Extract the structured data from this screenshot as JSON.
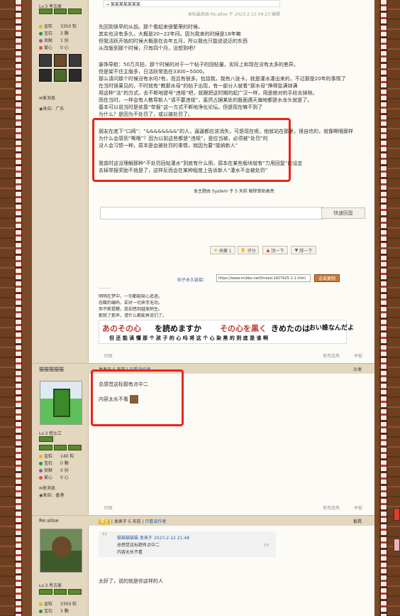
{
  "top_box": "→ 某某某某某某某",
  "post1": {
    "side": {
      "level": "Lv.3 考古家",
      "stats": [
        {
          "label": "金粒",
          "value": "3350 粒",
          "color": "#e6b800"
        },
        {
          "label": "宝石",
          "value": "3 颗",
          "color": "#1e9b3c"
        },
        {
          "label": "贡献",
          "value": "1 份",
          "color": "#9b59b6"
        },
        {
          "label": "爱心",
          "value": "0 心",
          "color": "#e74c3c"
        }
      ],
      "send_msg": "发消息",
      "from": "来自：广东"
    },
    "edited": "本帖最后由 Re:alloe 于 2023-2-13 04:23 编辑",
    "paragraphs": [
      "先回到很早的从前。那个看起来很繁荣的时候。",
      "其实也没有多久，大概是20~22年间。因为我来的时候是18年嘛",
      "但我活跃开始的时候大概是在去年五月，所以我也只能说说近的东西",
      "从改版到那个时候，只有四个月，没想到吧?",
      "",
      "装饰导航：50万共拍，那个时候的对于一个帖子的回帖量，实际上和现在没有太多的差异。",
      "但是架不住主版多，日活跃常态在3300~5000。",
      "那么请问那个时候没有水吗?有，而且有很多。包括我，我有八张卡，就是灌水灌出来的，不过那是20年的事情了",
      "在当时很果见的，不时就有“教那水母”的帖子出现，有一部分人就看“那水母”挣得盆满钵满",
      "用这种“法”的方式，去不断地提号“违规”吧，就跟把这时期的起广汉一样，用是绝对的手段去抹除。",
      "而在当时，一样会有人教导新人“请不要违规”，虽然占据某处的版面遇天偏地都是水龙头就是了。",
      "基本可以说当时是依靠“举报”这一方式不断地净化论坛。但是现在嘛不到了",
      "为什么？是因为不处罚了，或以被处罚了。"
    ],
    "highlight": [
      "朋友在底下“口阀”：“&&&&&&&&”的人，逼逼都应该消失，可是现在呢，他就站在那里，很自信的，就像嘶哦那样",
      "为什么会感到“嘶哦”？因为以前这些都是“违规”，是应当被，必须被“处罚”的",
      "没人会习惯一种，原本是会被处罚的事情，就因为要“接纳新人”",
      "",
      "我曾时这没理解那种“不处罚回帖灌水”到底有什么用，原本在某些版块就有“力用回复”的设定",
      "去掉举报奖励不就是了，这样反而会在某种程度上告诉新人“灌水不会被处罚”"
    ],
    "system_note": "本主题由 System 于 5 天前 解除锁贴高亮",
    "reply_button": "快速回复",
    "actions": [
      "收藏 1",
      "评分",
      "顶一下",
      "踩一下"
    ],
    "perma_label": "帖子永久链接：",
    "perma_url": "https://www.mcbbs.net/thread-1427425-1-1.html",
    "copy_button": "点击复制",
    "sig_head": "--------",
    "sig_lines": [
      "明明在梦中，一切都能吸心追逐。",
      "念酸的编码，却对一切来手无功。",
      "但不断提醒，我却感到越发陌生。",
      "那就了那声，请什么都能再说们了。"
    ],
    "banner_top_a": "あのその心",
    "banner_top_b": "を読めますか",
    "banner_top_c": "その心を黒く",
    "banner_top_d": "きめたのは",
    "banner_top_e": "おい誰なんだよ",
    "banner_bottom": "但 还 能 读 懂 那 个 孩 子 的 心 吗   将 这 个 心 染 黑 的   到 底 是 谁 啊",
    "footer_left": "回复",
    "footer_right": [
      "使用道具",
      "举报"
    ]
  },
  "post2": {
    "author": "猫猫猫猫猫",
    "meta": "发表于 5 天前",
    "only_author": "只看该作者",
    "floor": "沙发",
    "body_line1": "总感觉这标题有点中二",
    "body_line2": "内容太长不看",
    "side": {
      "level": "Lv.3 挖沙工",
      "stats": [
        {
          "label": "金粒",
          "value": "140 粒",
          "color": "#e6b800"
        },
        {
          "label": "宝石",
          "value": "0 颗",
          "color": "#1e9b3c"
        },
        {
          "label": "贡献",
          "value": "0 份",
          "color": "#9b59b6"
        },
        {
          "label": "爱心",
          "value": "0 心",
          "color": "#e74c3c"
        }
      ],
      "send_msg": "发消息",
      "from": "来自：香港"
    },
    "footer_left": "回复",
    "footer_right": [
      "使用道具",
      "举报"
    ]
  },
  "post3": {
    "author": "Re:alloe",
    "owner": "楼主",
    "meta": "发表于 5 天前",
    "only_author": "只看该作者",
    "floor": "板凳",
    "quote_head": "猫猫猫猫猫 发表于 2023-2-12 21:48",
    "quote_l1": "总感觉这标题有点中二",
    "quote_l2": "内容太长不看",
    "reply": "太好了，说的就是你这样的人",
    "side": {
      "level": "Lv.3 考古家",
      "stats": [
        {
          "label": "金粒",
          "value": "3350 粒",
          "color": "#e6b800"
        },
        {
          "label": "宝石",
          "value": "3 颗",
          "color": "#1e9b3c"
        }
      ]
    }
  },
  "colors": {
    "highlight": "#e8261a",
    "sidebar": "#e3d7c0",
    "accent": "#2f5fa2"
  }
}
